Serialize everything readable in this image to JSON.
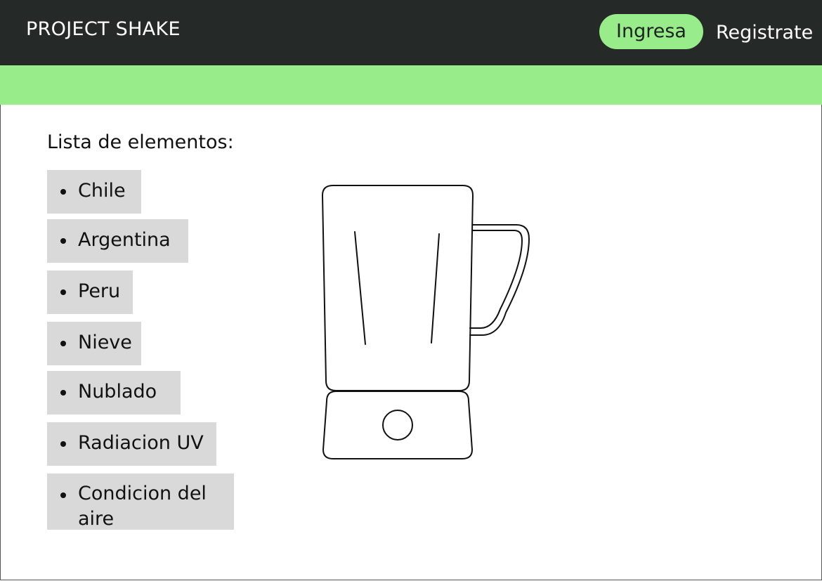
{
  "header": {
    "brand": "PROJECT SHAKE",
    "login_label": "Ingresa",
    "register_label": "Registrate"
  },
  "colors": {
    "header_bg": "#252928",
    "accent_green": "#98ec8a",
    "item_bg": "#d9d9d9"
  },
  "main": {
    "list_title": "Lista de elementos:",
    "items": [
      "Chile",
      "Argentina",
      "Peru",
      "Nieve",
      "Nublado",
      "Radiacion UV",
      "Condicion del aire"
    ],
    "illustration": "blender-icon"
  }
}
